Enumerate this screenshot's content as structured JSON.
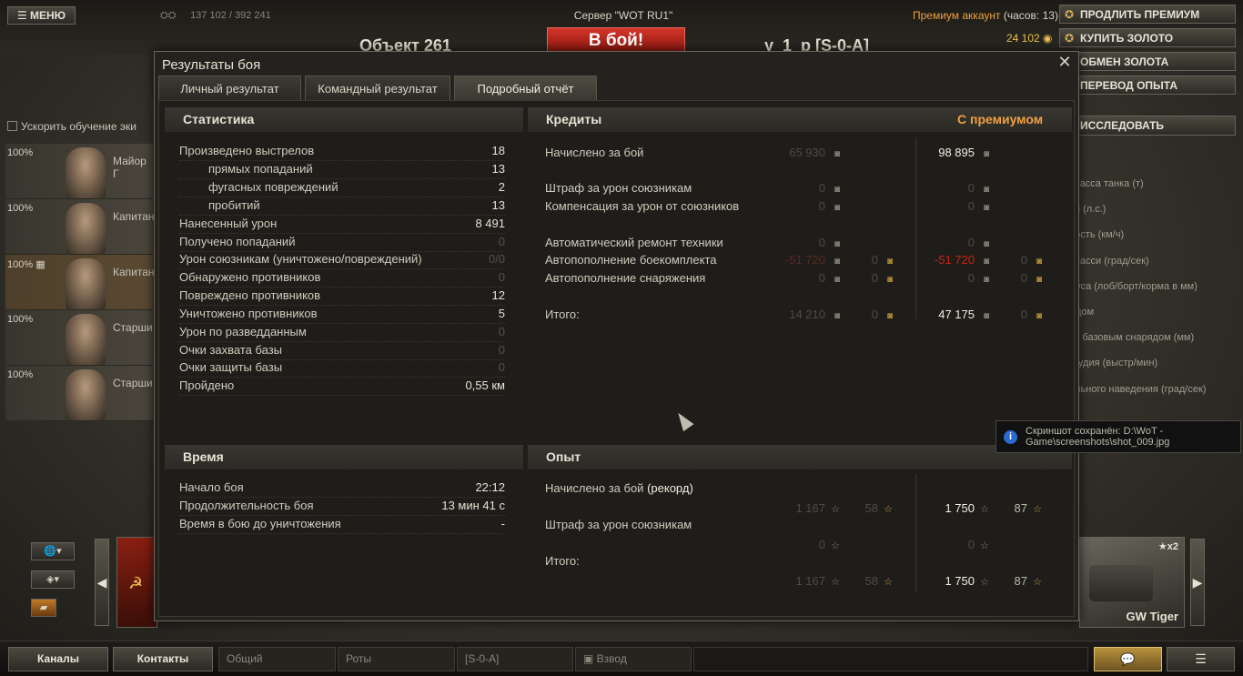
{
  "hangar": {
    "menu_label": "МЕНЮ",
    "xp_counter": "137 102 / 392 241",
    "server": "Сервер \"WOT RU1\"",
    "tank_name": "Объект 261",
    "battle_button": "В бой!",
    "platoon": "у_1_р [S-0-A]",
    "premium_label": "Премиум аккаунт",
    "premium_hours": "(часов: 13)",
    "gold": "24 102",
    "right_buttons": [
      "ПРОДЛИТЬ ПРЕМИУМ",
      "КУПИТЬ ЗОЛОТО",
      "ОБМЕН ЗОЛОТА",
      "ПЕРЕВОД ОПЫТА"
    ],
    "research_button": "ИССЛЕДОВАТЬ",
    "params": [
      "ая масса танка (т)",
      "теля (л.с.)",
      "корость (км/ч)",
      "та шасси (град/сек)",
      "орпуса (лоб/борт/корма в мм)",
      "арядом",
      "ость базовым снарядом (мм)",
      "ь орудия (выстр/мин)",
      "нтального наведения (град/сек)"
    ],
    "accelerate_label": "Ускорить обучение эки",
    "crew": [
      {
        "pct": "100%",
        "rank": "Майор Г"
      },
      {
        "pct": "100%",
        "rank": "Капитан"
      },
      {
        "pct": "100% ▦",
        "rank": "Капитан"
      },
      {
        "pct": "100%",
        "rank": "Старши"
      },
      {
        "pct": "100%",
        "rank": "Старши"
      }
    ],
    "vehicle_right": {
      "name": "GW Tiger",
      "xp_mult": "★x2"
    },
    "bottom": {
      "channels": "Каналы",
      "contacts": "Контакты",
      "tabs": [
        "Общий",
        "Роты",
        "[S-0-A]",
        "Взвод"
      ]
    }
  },
  "dialog": {
    "title": "Результаты боя",
    "close_icon": "close-icon",
    "tabs": [
      "Личный результат",
      "Командный результат",
      "Подробный отчёт"
    ],
    "active_tab": 2,
    "statistics": {
      "header": "Статистика",
      "rows": [
        {
          "label": "Произведено выстрелов",
          "value": "18"
        },
        {
          "label": "прямых попаданий",
          "value": "13"
        },
        {
          "label": "фугасных повреждений",
          "value": "2"
        },
        {
          "label": "пробитий",
          "value": "13"
        },
        {
          "label": "Нанесенный урон",
          "value": "8 491"
        },
        {
          "label": "Получено попаданий",
          "value": "0"
        },
        {
          "label": "Урон союзникам (уничтожено/повреждений)",
          "value": "0/0"
        },
        {
          "label": "Обнаружено противников",
          "value": "0"
        },
        {
          "label": "Повреждено противников",
          "value": "12"
        },
        {
          "label": "Уничтожено противников",
          "value": "5"
        },
        {
          "label": "Урон по разведданным",
          "value": "0"
        },
        {
          "label": "Очки захвата базы",
          "value": "0"
        },
        {
          "label": "Очки защиты базы",
          "value": "0"
        },
        {
          "label": "Пройдено",
          "value": "0,55 км"
        }
      ]
    },
    "credits": {
      "header": "Кредиты",
      "premium_header": "С премиумом",
      "rows": [
        {
          "label": "Начислено за бой",
          "base": "65 930",
          "premium": "98 895"
        },
        {
          "label": "Штраф за урон союзникам",
          "base": "0",
          "premium": "0"
        },
        {
          "label": "Компенсация за урон от союзников",
          "base": "0",
          "premium": "0"
        },
        {
          "label": "Автоматический ремонт техники",
          "base": "0",
          "premium": "0"
        },
        {
          "label": "Автопополнение боекомплекта",
          "base": "-51 720",
          "base_gold": "0",
          "premium": "-51 720",
          "premium_gold": "0"
        },
        {
          "label": "Автопополнение снаряжения",
          "base": "0",
          "base_gold": "0",
          "premium": "0",
          "premium_gold": "0"
        },
        {
          "label": "Итого:",
          "base": "14 210",
          "base_gold": "0",
          "premium": "47 175",
          "premium_gold": "0"
        }
      ]
    },
    "time": {
      "header": "Время",
      "rows": [
        {
          "label": "Начало боя",
          "value": "22:12"
        },
        {
          "label": "Продолжительность боя",
          "value": "13 мин 41 с"
        },
        {
          "label": "Время в бою до уничтожения",
          "value": "-"
        }
      ]
    },
    "experience": {
      "header": "Опыт",
      "earned_label": "Начислено за бой",
      "record_label": "(рекорд)",
      "penalty_label": "Штраф за урон союзникам",
      "total_label": "Итого:",
      "earned": {
        "base": "1 167",
        "base_free": "58",
        "premium": "1 750",
        "premium_free": "87"
      },
      "penalty": {
        "base": "0",
        "premium": "0"
      },
      "total": {
        "base": "1 167",
        "base_free": "58",
        "premium": "1 750",
        "premium_free": "87"
      }
    }
  },
  "toast": {
    "text": "Скриншот сохранён: D:\\WoT - Game\\screenshots\\shot_009.jpg"
  }
}
